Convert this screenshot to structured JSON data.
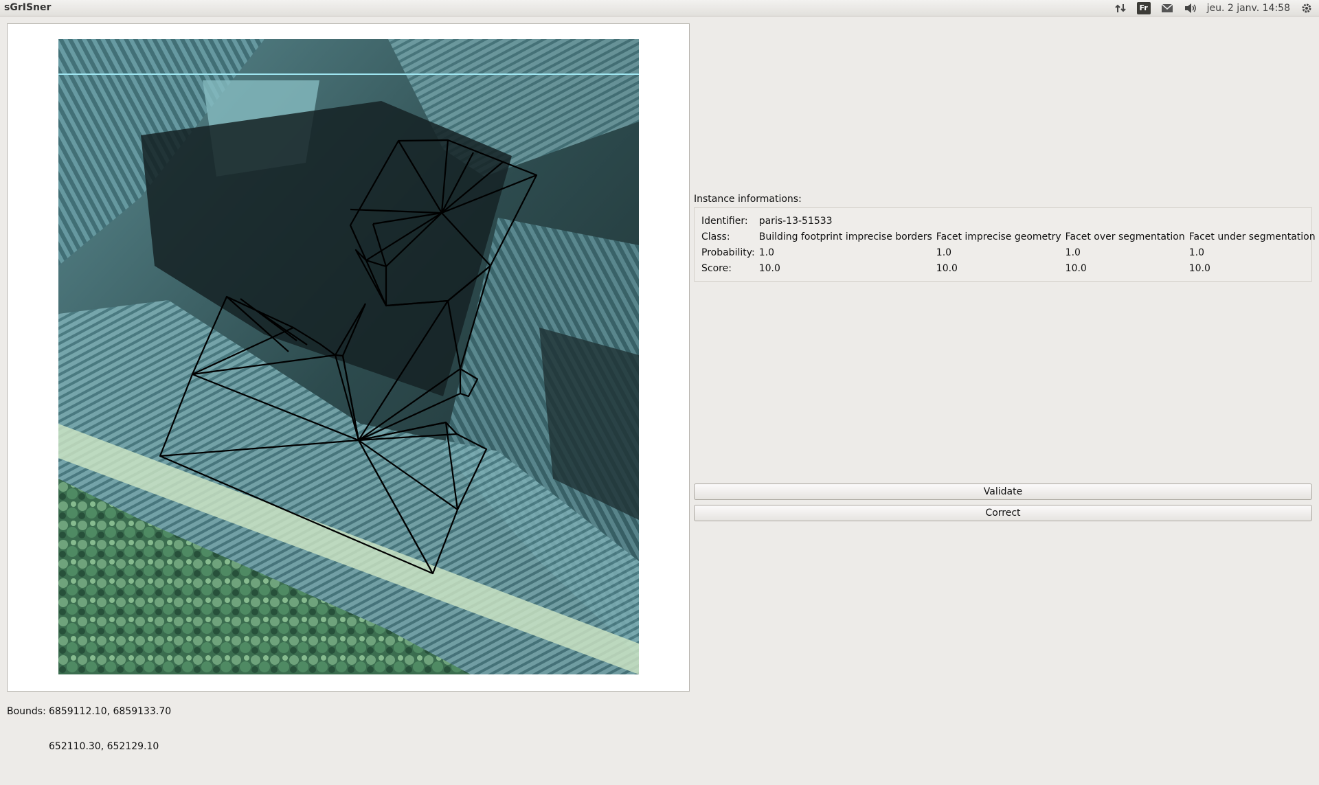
{
  "window": {
    "title": "sGrISner"
  },
  "tray": {
    "keyboard_layout": "Fr",
    "datetime": "jeu.  2 janv. 14:58",
    "icons": [
      "network-updown-icon",
      "keyboard-layout-icon",
      "mail-icon",
      "volume-icon",
      "gear-icon"
    ]
  },
  "bounds": {
    "label": "Bounds:",
    "row1": "6859112.10, 6859133.70",
    "row2": "652110.30, 652129.10"
  },
  "instance": {
    "title": "Instance informations:",
    "identifier_label": "Identifier:",
    "identifier": "paris-13-51533",
    "class_label": "Class:",
    "probability_label": "Probability:",
    "score_label": "Score:",
    "columns": [
      {
        "class": "Building footprint imprecise borders",
        "probability": "1.0",
        "score": "10.0"
      },
      {
        "class": "Facet imprecise geometry",
        "probability": "1.0",
        "score": "10.0"
      },
      {
        "class": "Facet over segmentation",
        "probability": "1.0",
        "score": "10.0"
      },
      {
        "class": "Facet under segmentation",
        "probability": "1.0",
        "score": "10.0"
      }
    ]
  },
  "actions": {
    "validate": "Validate",
    "correct": "Correct"
  }
}
